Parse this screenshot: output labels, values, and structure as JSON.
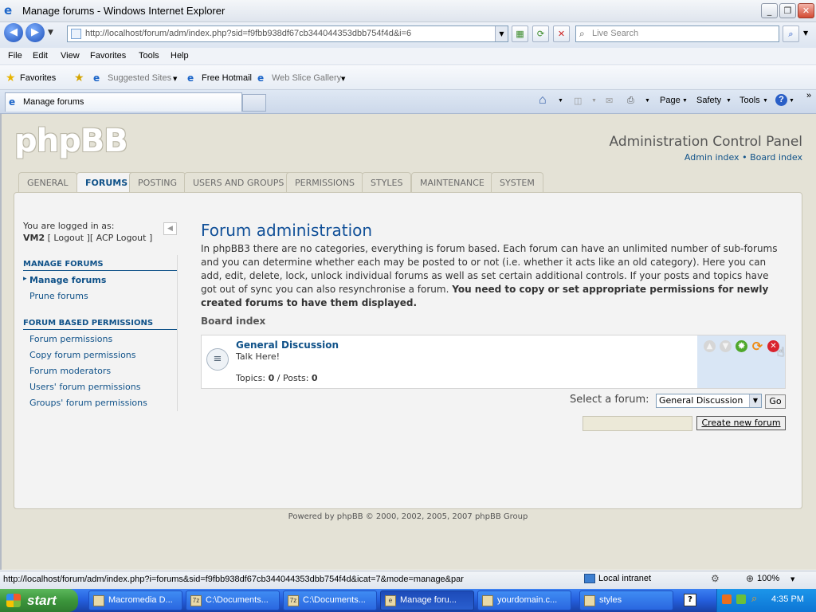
{
  "window": {
    "title": "Manage forums - Windows Internet Explorer"
  },
  "browser": {
    "address": "http://localhost/forum/adm/index.php?sid=f9fbb938df67cb344044353dbb754f4d&i=6",
    "search_placeholder": "Live Search",
    "menu": [
      "File",
      "Edit",
      "View",
      "Favorites",
      "Tools",
      "Help"
    ],
    "favorites_label": "Favorites",
    "favorites": [
      "Suggested Sites",
      "Free Hotmail",
      "Web Slice Gallery"
    ],
    "tab_title": "Manage forums",
    "toolbar": {
      "page": "Page",
      "safety": "Safety",
      "tools": "Tools"
    },
    "status_url": "http://localhost/forum/adm/index.php?i=forums&sid=f9fbb938df67cb344044353dbb754f4d&icat=7&mode=manage&par",
    "zone": "Local intranet",
    "zoom": "100%"
  },
  "acp": {
    "logo": "phpBB",
    "title": "Administration Control Panel",
    "links": {
      "admin_index": "Admin index",
      "sep": "•",
      "board_index": "Board index"
    },
    "tabs": [
      "GENERAL",
      "FORUMS",
      "POSTING",
      "USERS AND GROUPS",
      "PERMISSIONS",
      "STYLES",
      "MAINTENANCE",
      "SYSTEM"
    ],
    "active_tab": "FORUMS"
  },
  "sidebar": {
    "logged_in_label": "You are logged in as:",
    "username": "VM2",
    "logout": "[ Logout ]",
    "acp_logout": "[ ACP Logout ]",
    "sections": [
      {
        "title": "MANAGE FORUMS",
        "items": [
          "Manage forums",
          "Prune forums"
        ]
      },
      {
        "title": "FORUM BASED PERMISSIONS",
        "items": [
          "Forum permissions",
          "Copy forum permissions",
          "Forum moderators",
          "Users' forum permissions",
          "Groups' forum permissions"
        ]
      }
    ]
  },
  "main": {
    "title": "Forum administration",
    "desc": "In phpBB3 there are no categories, everything is forum based. Each forum can have an unlimited number of sub-forums and you can determine whether each may be posted to or not (i.e. whether it acts like an old category). Here you can add, edit, delete, lock, unlock individual forums as well as set certain additional controls. If your posts and topics have got out of sync you can also resynchronise a forum.",
    "desc_bold": "You need to copy or set appropriate permissions for newly created forums to have them displayed.",
    "breadcrumb": "Board index",
    "forum": {
      "name": "General Discussion",
      "description": "Talk Here!",
      "topics_label": "Topics:",
      "topics": "0",
      "posts_label": "/ Posts:",
      "posts": "0"
    },
    "select_label": "Select a forum:",
    "select_value": "General Discussion",
    "go": "Go",
    "create": "Create new forum"
  },
  "footer": "Powered by phpBB © 2000, 2002, 2005, 2007 phpBB Group",
  "taskbar": {
    "start": "start",
    "tasks": [
      "Macromedia D...",
      "C:\\Documents...",
      "C:\\Documents...",
      "Manage foru...",
      "yourdomain.c...",
      "styles"
    ],
    "clock": "4:35 PM"
  }
}
